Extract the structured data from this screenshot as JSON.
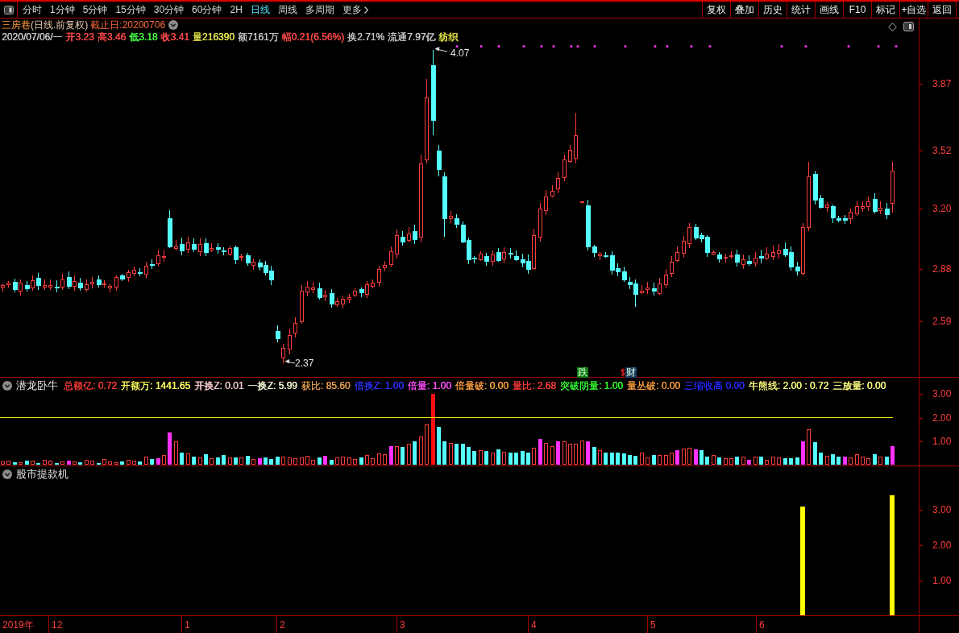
{
  "toolbar": {
    "tabs": [
      {
        "label": "分时",
        "selected": false
      },
      {
        "label": "1分钟",
        "selected": false
      },
      {
        "label": "5分钟",
        "selected": false
      },
      {
        "label": "15分钟",
        "selected": false
      },
      {
        "label": "30分钟",
        "selected": false
      },
      {
        "label": "60分钟",
        "selected": false
      },
      {
        "label": "2H",
        "selected": false
      },
      {
        "label": "日线",
        "selected": true
      },
      {
        "label": "周线",
        "selected": false
      },
      {
        "label": "多周期",
        "selected": false
      }
    ],
    "more": "更多",
    "buttons": [
      "复权",
      "叠加",
      "历史",
      "统计",
      "画线",
      "F10",
      "标记",
      "+自选",
      "返回"
    ]
  },
  "main_chart": {
    "stock_name": "三房巷",
    "period": "(日线.前复权)",
    "end_date": "截止日:20200706",
    "quote": [
      {
        "text": "2020/07/06/一",
        "color": "#c8c8c8"
      },
      {
        "text": "开3.23",
        "color": "#ff4a4a"
      },
      {
        "text": "高3.46",
        "color": "#ff4a4a"
      },
      {
        "text": "低3.18",
        "color": "#4aff4a"
      },
      {
        "text": "收3.41",
        "color": "#ff4a4a"
      },
      {
        "text": "量216390",
        "color": "#e6e64a"
      },
      {
        "text": "额7161万",
        "color": "#c8c8c8"
      },
      {
        "text": "幅0.21(6.56%)",
        "color": "#ff4a4a"
      },
      {
        "text": "换2.71%",
        "color": "#c8c8c8"
      },
      {
        "text": "流通7.97亿",
        "color": "#c8c8c8"
      },
      {
        "text": "纺织",
        "color": "#e6e64a"
      }
    ],
    "price_axis": [
      "3.87",
      "3.52",
      "3.20",
      "2.88",
      "2.59"
    ],
    "high_label": "4.07",
    "low_label": "2.37",
    "signals": [
      {
        "text": "跌",
        "color": "#107a10"
      },
      {
        "text": "财",
        "color": "#1c3c64"
      }
    ]
  },
  "indicator_1": {
    "name": "潜龙卧牛",
    "params": [
      {
        "text": "总额亿: 0.72",
        "color": "#ff3c3c"
      },
      {
        "text": "开额万: 1441.65",
        "color": "#ffff5a"
      },
      {
        "text": "开换Z: 0.01",
        "color": "#f0c8c8"
      },
      {
        "text": "一换Z: 5.99",
        "color": "#f0f0d0"
      },
      {
        "text": "获比: 85.60",
        "color": "#e8a050"
      },
      {
        "text": "倍换Z: 1.00",
        "color": "#3232ff"
      },
      {
        "text": "倍量: 1.00",
        "color": "#ff50ff"
      },
      {
        "text": "倍量破: 0.00",
        "color": "#ffa040"
      },
      {
        "text": "量比: 2.68",
        "color": "#ff3c3c"
      },
      {
        "text": "突破阴量: 1.00",
        "color": "#32ff32"
      },
      {
        "text": "量丛破: 0.00",
        "color": "#ffa040"
      },
      {
        "text": "三缩收高 0.00",
        "color": "#2828ff"
      },
      {
        "text": "牛熊线: 2.00 : 0.72",
        "color": "#ffff80"
      },
      {
        "text": "三放量: 0.00",
        "color": "#ffff80"
      }
    ],
    "axis": [
      "3.00",
      "2.00",
      "1.00"
    ]
  },
  "indicator_2": {
    "name": "股市提款机",
    "axis": [
      "3.00",
      "2.00",
      "1.00"
    ]
  },
  "time_axis": [
    "2019年",
    "12",
    "1",
    "2",
    "3",
    "4",
    "5",
    "6"
  ]
}
